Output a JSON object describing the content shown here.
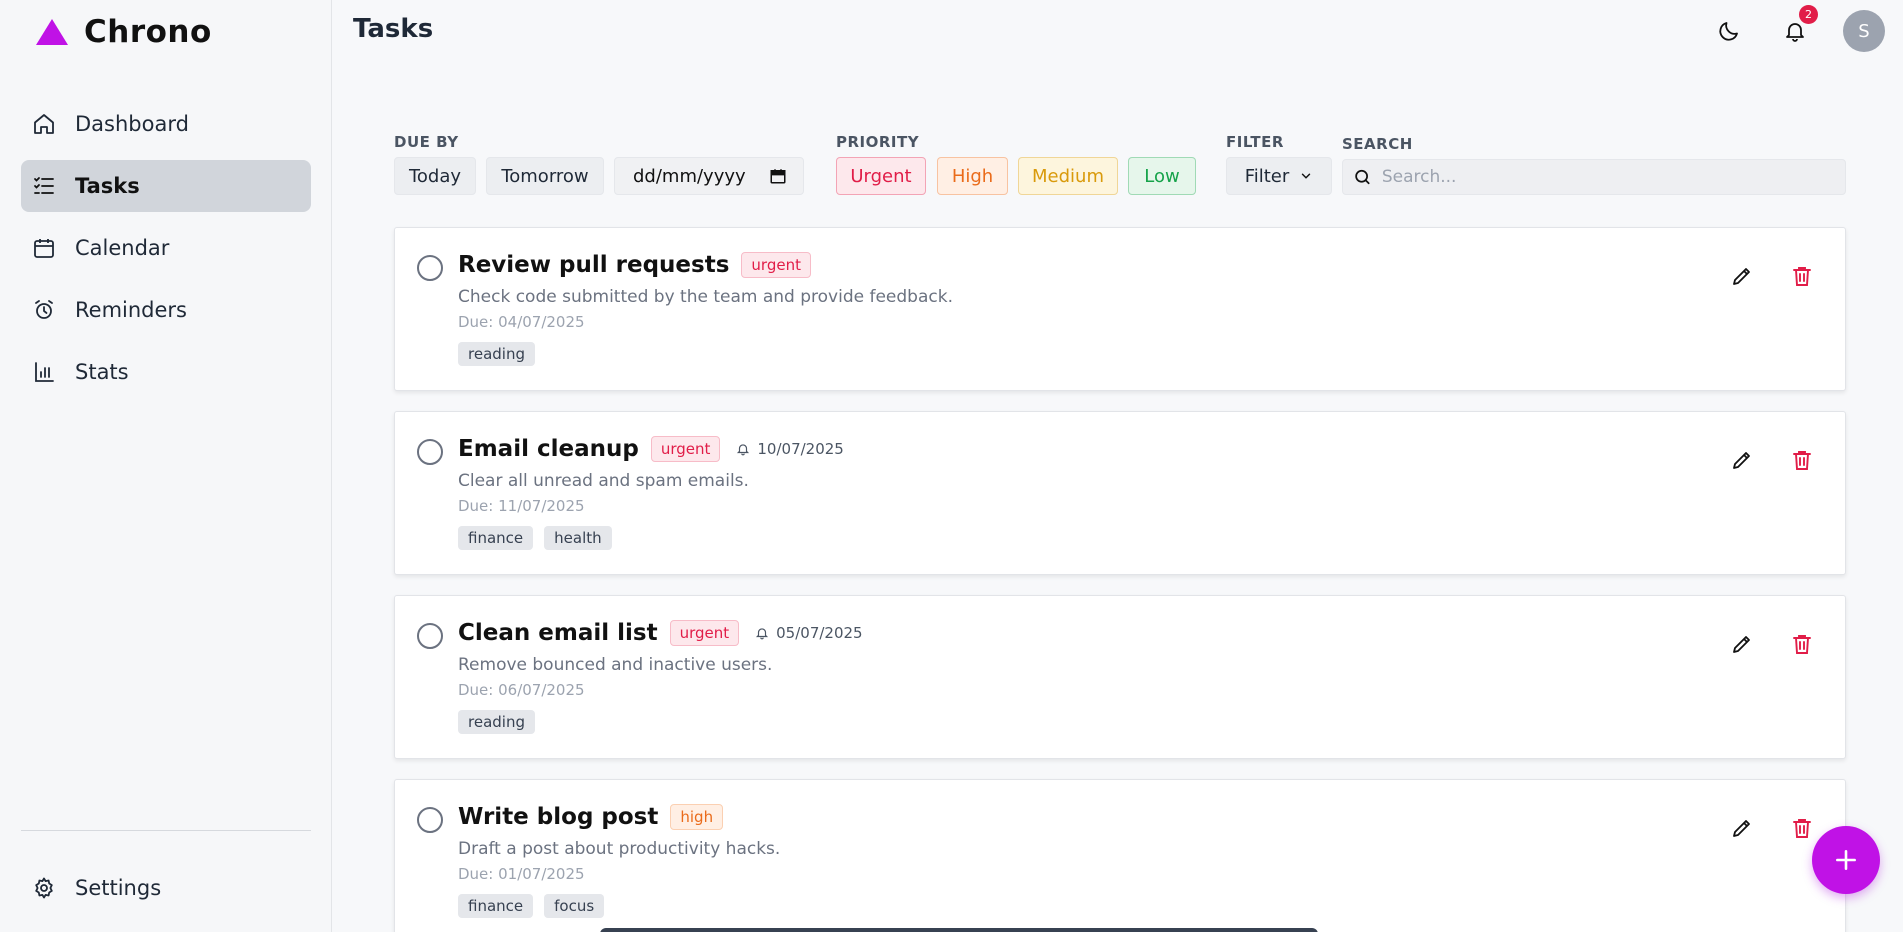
{
  "app": {
    "name": "Chrono",
    "brand_color": "#c012e6"
  },
  "sidebar": {
    "items": [
      {
        "label": "Dashboard",
        "icon": "home-icon",
        "active": false
      },
      {
        "label": "Tasks",
        "icon": "list-check-icon",
        "active": true
      },
      {
        "label": "Calendar",
        "icon": "calendar-icon",
        "active": false
      },
      {
        "label": "Reminders",
        "icon": "alarm-clock-icon",
        "active": false
      },
      {
        "label": "Stats",
        "icon": "bar-chart-icon",
        "active": false
      }
    ],
    "settings_label": "Settings"
  },
  "header": {
    "title": "Tasks",
    "notification_count": "2",
    "avatar_initial": "S"
  },
  "filters": {
    "due_by_label": "DUE BY",
    "today_label": "Today",
    "tomorrow_label": "Tomorrow",
    "date_placeholder": "dd/mm/yyyy",
    "priority_label": "PRIORITY",
    "priorities": [
      {
        "label": "Urgent",
        "color": "#e11d48",
        "bg": "#fde8ec"
      },
      {
        "label": "High",
        "color": "#ea6b1a",
        "bg": "#ffefe4"
      },
      {
        "label": "Medium",
        "color": "#d99a0b",
        "bg": "#fdf5dd"
      },
      {
        "label": "Low",
        "color": "#16a34a",
        "bg": "#e6f6eb"
      }
    ],
    "filter_label": "FILTER",
    "filter_button": "Filter",
    "search_label": "SEARCH",
    "search_placeholder": "Search..."
  },
  "tasks": [
    {
      "title": "Review pull requests",
      "priority": "urgent",
      "reminder": "",
      "description": "Check code submitted by the team and provide feedback.",
      "due": "Due: 04/07/2025",
      "tags": [
        "reading"
      ]
    },
    {
      "title": "Email cleanup",
      "priority": "urgent",
      "reminder": "10/07/2025",
      "description": "Clear all unread and spam emails.",
      "due": "Due: 11/07/2025",
      "tags": [
        "finance",
        "health"
      ]
    },
    {
      "title": "Clean email list",
      "priority": "urgent",
      "reminder": "05/07/2025",
      "description": "Remove bounced and inactive users.",
      "due": "Due: 06/07/2025",
      "tags": [
        "reading"
      ]
    },
    {
      "title": "Write blog post",
      "priority": "high",
      "reminder": "",
      "description": "Draft a post about productivity hacks.",
      "due": "Due: 01/07/2025",
      "tags": [
        "finance",
        "focus"
      ]
    }
  ]
}
